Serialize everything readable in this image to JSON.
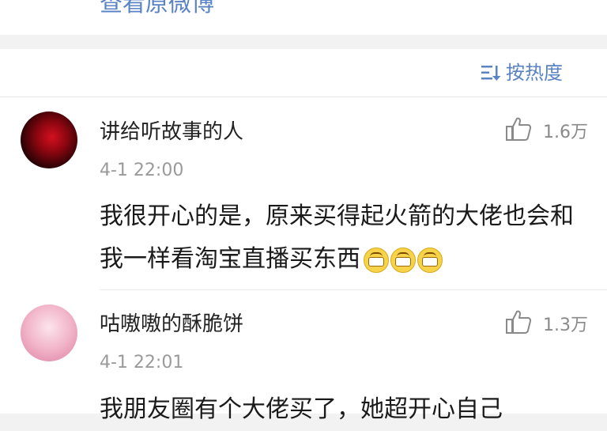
{
  "top": {
    "view_original": "查看原微博"
  },
  "sort": {
    "label": "按热度"
  },
  "comments": [
    {
      "username": "讲给听故事的人",
      "time": "4-1 22:00",
      "likes": "1.6万",
      "text": "我很开心的是，原来买得起火箭的大佬也会和我一样看淘宝直播买东西",
      "emoji_count": 3
    },
    {
      "username": "咕嗷嗷的酥脆饼",
      "time": "4-1 22:01",
      "likes": "1.3万",
      "text": "我朋友圈有个大佬买了，她超开心自己"
    }
  ],
  "colors": {
    "link": "#5a83c4",
    "text": "#1a1a1a",
    "muted": "#9a9a9a"
  }
}
